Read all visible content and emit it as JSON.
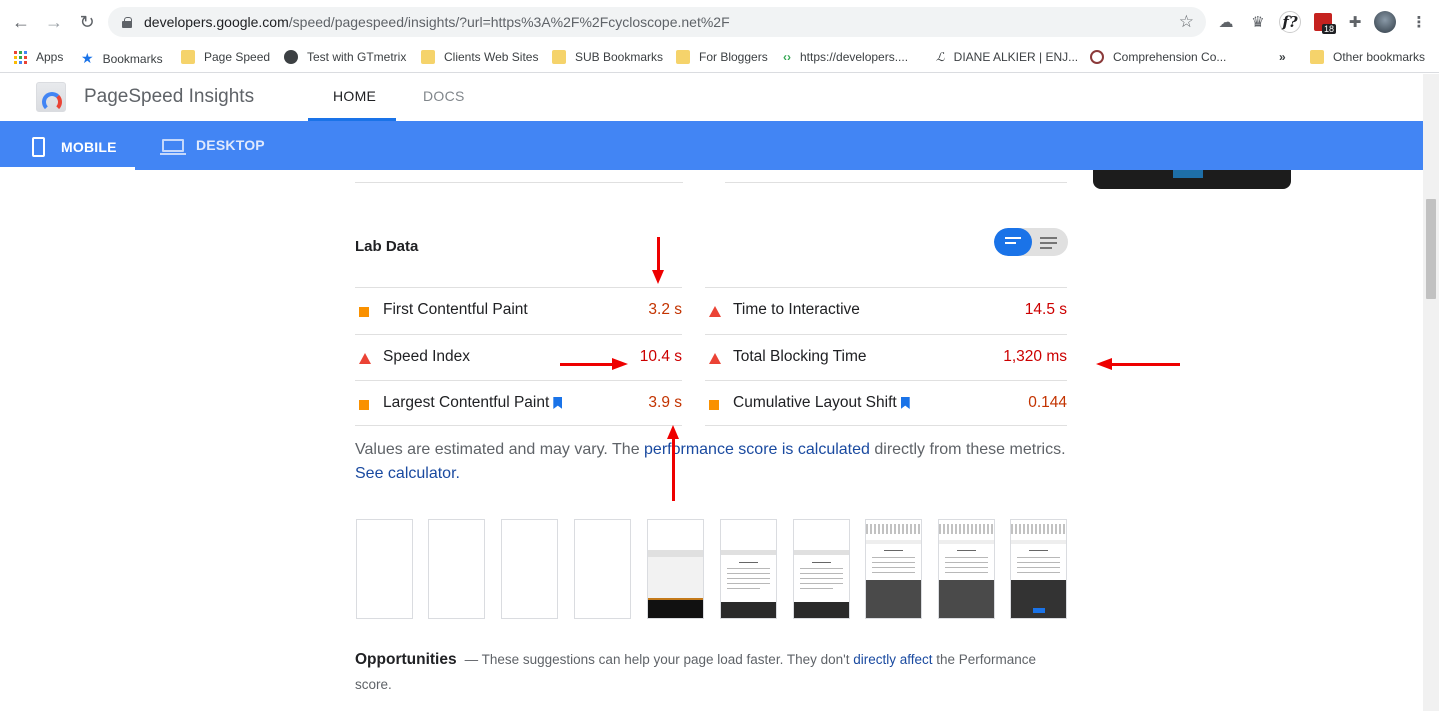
{
  "browser": {
    "url_host": "developers.google.com",
    "url_rest": "/speed/pagespeed/insights/?url=https%3A%2F%2Fcycloscope.net%2F",
    "ext_badge": "18"
  },
  "bookmarks": [
    {
      "label": "Apps",
      "icon": "apps-grid-icon"
    },
    {
      "label": "Bookmarks",
      "icon": "star-icon"
    },
    {
      "label": "Page Speed",
      "icon": "folder-icon"
    },
    {
      "label": "Test with GTmetrix",
      "icon": "globe-icon"
    },
    {
      "label": "Clients Web Sites",
      "icon": "folder-icon"
    },
    {
      "label": "SUB Bookmarks",
      "icon": "folder-icon"
    },
    {
      "label": "For Bloggers",
      "icon": "folder-icon"
    },
    {
      "label": "https://developers....",
      "icon": "code-icon"
    },
    {
      "label": "DIANE ALKIER | ENJ...",
      "icon": "signature-icon"
    },
    {
      "label": "Comprehension Co...",
      "icon": "site-icon"
    },
    {
      "label": "Other bookmarks",
      "icon": "folder-icon"
    }
  ],
  "header": {
    "title": "PageSpeed Insights",
    "tabs": [
      "HOME",
      "DOCS"
    ]
  },
  "devices": {
    "mobile": "MOBILE",
    "desktop": "DESKTOP"
  },
  "lab": {
    "title": "Lab Data",
    "metrics_left": [
      {
        "name": "First Contentful Paint",
        "value": "3.2 s",
        "status": "average"
      },
      {
        "name": "Speed Index",
        "value": "10.4 s",
        "status": "fail"
      },
      {
        "name": "Largest Contentful Paint",
        "value": "3.9 s",
        "status": "average"
      }
    ],
    "metrics_right": [
      {
        "name": "Time to Interactive",
        "value": "14.5 s",
        "status": "fail"
      },
      {
        "name": "Total Blocking Time",
        "value": "1,320 ms",
        "status": "fail"
      },
      {
        "name": "Cumulative Layout Shift",
        "value": "0.144",
        "status": "average"
      }
    ],
    "note_part1": "Values are estimated and may vary. The ",
    "note_link1": "performance score is calculated",
    "note_part2": " directly from these metrics. ",
    "note_link2": "See calculator."
  },
  "opportunities": {
    "title": "Opportunities",
    "text1": "— These suggestions can help your page load faster. They don't ",
    "link": "directly affect",
    "text2": " the Performance score."
  },
  "colors": {
    "accent": "#4285f4",
    "average": "#fa9100",
    "fail": "#eb4335",
    "link": "#1a4aa0"
  }
}
